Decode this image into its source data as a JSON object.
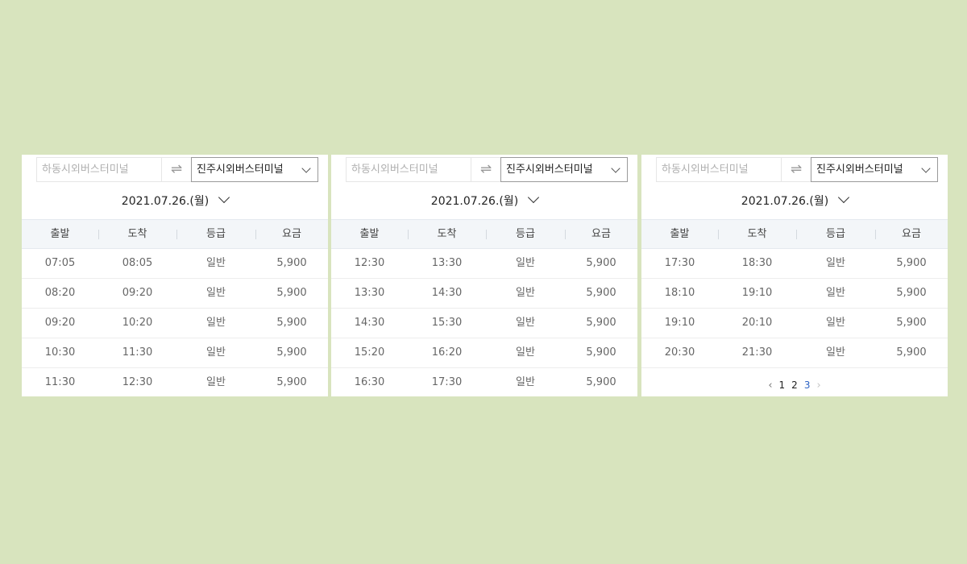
{
  "panels": [
    {
      "origin": "하동시외버스터미널",
      "swap_icon": "⇌",
      "destination": "진주시외버스터미널",
      "date": "2021.07.26.(월)",
      "headers": [
        "출발",
        "도착",
        "등급",
        "요금"
      ],
      "rows": [
        [
          "07:05",
          "08:05",
          "일반",
          "5,900"
        ],
        [
          "08:20",
          "09:20",
          "일반",
          "5,900"
        ],
        [
          "09:20",
          "10:20",
          "일반",
          "5,900"
        ],
        [
          "10:30",
          "11:30",
          "일반",
          "5,900"
        ],
        [
          "11:30",
          "12:30",
          "일반",
          "5,900"
        ]
      ]
    },
    {
      "origin": "하동시외버스터미널",
      "swap_icon": "⇌",
      "destination": "진주시외버스터미널",
      "date": "2021.07.26.(월)",
      "headers": [
        "출발",
        "도착",
        "등급",
        "요금"
      ],
      "rows": [
        [
          "12:30",
          "13:30",
          "일반",
          "5,900"
        ],
        [
          "13:30",
          "14:30",
          "일반",
          "5,900"
        ],
        [
          "14:30",
          "15:30",
          "일반",
          "5,900"
        ],
        [
          "15:20",
          "16:20",
          "일반",
          "5,900"
        ],
        [
          "16:30",
          "17:30",
          "일반",
          "5,900"
        ]
      ]
    },
    {
      "origin": "하동시외버스터미널",
      "swap_icon": "⇌",
      "destination": "진주시외버스터미널",
      "date": "2021.07.26.(월)",
      "headers": [
        "출발",
        "도착",
        "등급",
        "요금"
      ],
      "rows": [
        [
          "17:30",
          "18:30",
          "일반",
          "5,900"
        ],
        [
          "18:10",
          "19:10",
          "일반",
          "5,900"
        ],
        [
          "19:10",
          "20:10",
          "일반",
          "5,900"
        ],
        [
          "20:30",
          "21:30",
          "일반",
          "5,900"
        ]
      ],
      "pagination": {
        "prev_icon": "‹",
        "pages": [
          "1",
          "2",
          "3"
        ],
        "current": "3",
        "next_icon": "›"
      }
    }
  ],
  "colors": {
    "background": "#d8e4be",
    "panel": "#ffffff",
    "header_bg": "#f3f6f9",
    "active_page": "#2c63c4"
  }
}
